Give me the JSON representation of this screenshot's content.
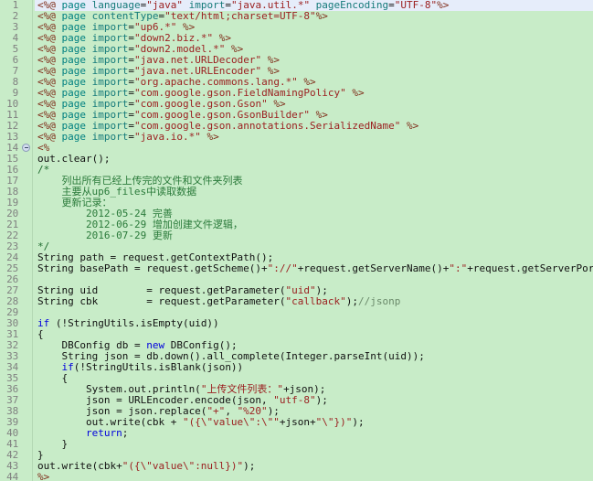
{
  "editor": {
    "name": "jsp-code-editor",
    "background": "#c8ecc8",
    "selection_color": "#e6edfa",
    "gutter_color": "#808080",
    "total_lines": 44,
    "fold_marker_line": 14
  },
  "lines": [
    {
      "n": "1",
      "selected": true,
      "fold": false,
      "tokens": [
        {
          "c": "t-dir",
          "t": "<%@"
        },
        {
          "c": "t-tag",
          "t": " page "
        },
        {
          "c": "t-attr",
          "t": "language"
        },
        {
          "c": "t-plain",
          "t": "="
        },
        {
          "c": "t-str",
          "t": "\"java\""
        },
        {
          "c": "t-attr",
          "t": " import"
        },
        {
          "c": "t-plain",
          "t": "="
        },
        {
          "c": "t-str",
          "t": "\"java.util.*\""
        },
        {
          "c": "t-attr",
          "t": " pageEncoding"
        },
        {
          "c": "t-plain",
          "t": "="
        },
        {
          "c": "t-str",
          "t": "\"UTF-8\""
        },
        {
          "c": "t-dir",
          "t": "%>"
        }
      ]
    },
    {
      "n": "2",
      "selected": false,
      "fold": false,
      "tokens": [
        {
          "c": "t-dir",
          "t": "<%@"
        },
        {
          "c": "t-tag",
          "t": " page "
        },
        {
          "c": "t-attr",
          "t": "contentType"
        },
        {
          "c": "t-plain",
          "t": "="
        },
        {
          "c": "t-str",
          "t": "\"text/html;charset=UTF-8\""
        },
        {
          "c": "t-dir",
          "t": "%>"
        }
      ]
    },
    {
      "n": "3",
      "selected": false,
      "fold": false,
      "tokens": [
        {
          "c": "t-dir",
          "t": "<%@"
        },
        {
          "c": "t-tag",
          "t": " page "
        },
        {
          "c": "t-attr",
          "t": "import"
        },
        {
          "c": "t-plain",
          "t": "="
        },
        {
          "c": "t-str",
          "t": "\"up6.*\""
        },
        {
          "c": "t-dir",
          "t": " %>"
        }
      ]
    },
    {
      "n": "4",
      "selected": false,
      "fold": false,
      "tokens": [
        {
          "c": "t-dir",
          "t": "<%@"
        },
        {
          "c": "t-tag",
          "t": " page "
        },
        {
          "c": "t-attr",
          "t": "import"
        },
        {
          "c": "t-plain",
          "t": "="
        },
        {
          "c": "t-str",
          "t": "\"down2.biz.*\""
        },
        {
          "c": "t-dir",
          "t": " %>"
        }
      ]
    },
    {
      "n": "5",
      "selected": false,
      "fold": false,
      "tokens": [
        {
          "c": "t-dir",
          "t": "<%@"
        },
        {
          "c": "t-tag",
          "t": " page "
        },
        {
          "c": "t-attr",
          "t": "import"
        },
        {
          "c": "t-plain",
          "t": "="
        },
        {
          "c": "t-str",
          "t": "\"down2.model.*\""
        },
        {
          "c": "t-dir",
          "t": " %>"
        }
      ]
    },
    {
      "n": "6",
      "selected": false,
      "fold": false,
      "tokens": [
        {
          "c": "t-dir",
          "t": "<%@"
        },
        {
          "c": "t-tag",
          "t": " page "
        },
        {
          "c": "t-attr",
          "t": "import"
        },
        {
          "c": "t-plain",
          "t": "="
        },
        {
          "c": "t-str",
          "t": "\"java.net.URLDecoder\""
        },
        {
          "c": "t-dir",
          "t": " %>"
        }
      ]
    },
    {
      "n": "7",
      "selected": false,
      "fold": false,
      "tokens": [
        {
          "c": "t-dir",
          "t": "<%@"
        },
        {
          "c": "t-tag",
          "t": " page "
        },
        {
          "c": "t-attr",
          "t": "import"
        },
        {
          "c": "t-plain",
          "t": "="
        },
        {
          "c": "t-str",
          "t": "\"java.net.URLEncoder\""
        },
        {
          "c": "t-dir",
          "t": " %>"
        }
      ]
    },
    {
      "n": "8",
      "selected": false,
      "fold": false,
      "tokens": [
        {
          "c": "t-dir",
          "t": "<%@"
        },
        {
          "c": "t-tag",
          "t": " page "
        },
        {
          "c": "t-attr",
          "t": "import"
        },
        {
          "c": "t-plain",
          "t": "="
        },
        {
          "c": "t-str",
          "t": "\"org.apache.commons.lang.*\""
        },
        {
          "c": "t-dir",
          "t": " %>"
        }
      ]
    },
    {
      "n": "9",
      "selected": false,
      "fold": false,
      "tokens": [
        {
          "c": "t-dir",
          "t": "<%@"
        },
        {
          "c": "t-tag",
          "t": " page "
        },
        {
          "c": "t-attr",
          "t": "import"
        },
        {
          "c": "t-plain",
          "t": "="
        },
        {
          "c": "t-str",
          "t": "\"com.google.gson.FieldNamingPolicy\""
        },
        {
          "c": "t-dir",
          "t": " %>"
        }
      ]
    },
    {
      "n": "10",
      "selected": false,
      "fold": false,
      "tokens": [
        {
          "c": "t-dir",
          "t": "<%@"
        },
        {
          "c": "t-tag",
          "t": " page "
        },
        {
          "c": "t-attr",
          "t": "import"
        },
        {
          "c": "t-plain",
          "t": "="
        },
        {
          "c": "t-str",
          "t": "\"com.google.gson.Gson\""
        },
        {
          "c": "t-dir",
          "t": " %>"
        }
      ]
    },
    {
      "n": "11",
      "selected": false,
      "fold": false,
      "tokens": [
        {
          "c": "t-dir",
          "t": "<%@"
        },
        {
          "c": "t-tag",
          "t": " page "
        },
        {
          "c": "t-attr",
          "t": "import"
        },
        {
          "c": "t-plain",
          "t": "="
        },
        {
          "c": "t-str",
          "t": "\"com.google.gson.GsonBuilder\""
        },
        {
          "c": "t-dir",
          "t": " %>"
        }
      ]
    },
    {
      "n": "12",
      "selected": false,
      "fold": false,
      "tokens": [
        {
          "c": "t-dir",
          "t": "<%@"
        },
        {
          "c": "t-tag",
          "t": " page "
        },
        {
          "c": "t-attr",
          "t": "import"
        },
        {
          "c": "t-plain",
          "t": "="
        },
        {
          "c": "t-str",
          "t": "\"com.google.gson.annotations.SerializedName\""
        },
        {
          "c": "t-dir",
          "t": " %>"
        }
      ]
    },
    {
      "n": "13",
      "selected": false,
      "fold": false,
      "tokens": [
        {
          "c": "t-dir",
          "t": "<%@"
        },
        {
          "c": "t-tag",
          "t": " page "
        },
        {
          "c": "t-attr",
          "t": "import"
        },
        {
          "c": "t-plain",
          "t": "="
        },
        {
          "c": "t-str",
          "t": "\"java.io.*\""
        },
        {
          "c": "t-dir",
          "t": " %>"
        }
      ]
    },
    {
      "n": "14",
      "selected": false,
      "fold": true,
      "tokens": [
        {
          "c": "t-dir",
          "t": "<%"
        }
      ]
    },
    {
      "n": "15",
      "selected": false,
      "fold": false,
      "tokens": [
        {
          "c": "t-plain",
          "t": "out.clear();"
        }
      ]
    },
    {
      "n": "16",
      "selected": false,
      "fold": false,
      "tokens": [
        {
          "c": "t-cmt",
          "t": "/*"
        }
      ]
    },
    {
      "n": "17",
      "selected": false,
      "fold": false,
      "tokens": [
        {
          "c": "t-cmtcn",
          "t": "    列出所有已经上传完的文件和文件夹列表"
        }
      ]
    },
    {
      "n": "18",
      "selected": false,
      "fold": false,
      "tokens": [
        {
          "c": "t-cmtcn",
          "t": "    主要从up6_files中读取数据"
        }
      ]
    },
    {
      "n": "19",
      "selected": false,
      "fold": false,
      "tokens": [
        {
          "c": "t-cmtcn",
          "t": "    更新记录："
        }
      ]
    },
    {
      "n": "20",
      "selected": false,
      "fold": false,
      "tokens": [
        {
          "c": "t-cmtcn",
          "t": "        2012-05-24 完善"
        }
      ]
    },
    {
      "n": "21",
      "selected": false,
      "fold": false,
      "tokens": [
        {
          "c": "t-cmtcn",
          "t": "        2012-06-29 增加创建文件逻辑，"
        }
      ]
    },
    {
      "n": "22",
      "selected": false,
      "fold": false,
      "tokens": [
        {
          "c": "t-cmtcn",
          "t": "        2016-07-29 更新"
        }
      ]
    },
    {
      "n": "23",
      "selected": false,
      "fold": false,
      "tokens": [
        {
          "c": "t-cmt",
          "t": "*/"
        }
      ]
    },
    {
      "n": "24",
      "selected": false,
      "fold": false,
      "tokens": [
        {
          "c": "t-plain",
          "t": "String path = request.getContextPath();"
        }
      ]
    },
    {
      "n": "25",
      "selected": false,
      "fold": false,
      "tokens": [
        {
          "c": "t-plain",
          "t": "String basePath = request.getScheme()+"
        },
        {
          "c": "t-str",
          "t": "\"://\""
        },
        {
          "c": "t-plain",
          "t": "+request.getServerName()+"
        },
        {
          "c": "t-str",
          "t": "\":\""
        },
        {
          "c": "t-plain",
          "t": "+request.getServerPort()+path+"
        },
        {
          "c": "t-str",
          "t": "\"/\""
        },
        {
          "c": "t-plain",
          "t": ";"
        }
      ]
    },
    {
      "n": "26",
      "selected": false,
      "fold": false,
      "tokens": []
    },
    {
      "n": "27",
      "selected": false,
      "fold": false,
      "tokens": [
        {
          "c": "t-plain",
          "t": "String uid        = request.getParameter("
        },
        {
          "c": "t-str",
          "t": "\"uid\""
        },
        {
          "c": "t-plain",
          "t": ");"
        }
      ]
    },
    {
      "n": "28",
      "selected": false,
      "fold": false,
      "tokens": [
        {
          "c": "t-plain",
          "t": "String cbk        = request.getParameter("
        },
        {
          "c": "t-str",
          "t": "\"callback\""
        },
        {
          "c": "t-plain",
          "t": ");"
        },
        {
          "c": "t-linecmt",
          "t": "//jsonp"
        }
      ]
    },
    {
      "n": "29",
      "selected": false,
      "fold": false,
      "tokens": []
    },
    {
      "n": "30",
      "selected": false,
      "fold": false,
      "tokens": [
        {
          "c": "t-kw",
          "t": "if"
        },
        {
          "c": "t-plain",
          "t": " (!StringUtils.isEmpty(uid))"
        }
      ]
    },
    {
      "n": "31",
      "selected": false,
      "fold": false,
      "tokens": [
        {
          "c": "t-plain",
          "t": "{"
        }
      ]
    },
    {
      "n": "32",
      "selected": false,
      "fold": false,
      "tokens": [
        {
          "c": "t-plain",
          "t": "    DBConfig db = "
        },
        {
          "c": "t-kw",
          "t": "new"
        },
        {
          "c": "t-plain",
          "t": " DBConfig();"
        }
      ]
    },
    {
      "n": "33",
      "selected": false,
      "fold": false,
      "tokens": [
        {
          "c": "t-plain",
          "t": "    String json = db.down().all_complete(Integer.parseInt(uid));"
        }
      ]
    },
    {
      "n": "34",
      "selected": false,
      "fold": false,
      "tokens": [
        {
          "c": "t-plain",
          "t": "    "
        },
        {
          "c": "t-kw",
          "t": "if"
        },
        {
          "c": "t-plain",
          "t": "(!StringUtils.isBlank(json))"
        }
      ]
    },
    {
      "n": "35",
      "selected": false,
      "fold": false,
      "tokens": [
        {
          "c": "t-plain",
          "t": "    {"
        }
      ]
    },
    {
      "n": "36",
      "selected": false,
      "fold": false,
      "tokens": [
        {
          "c": "t-plain",
          "t": "        System.out.println("
        },
        {
          "c": "t-str",
          "t": "\"上传文件列表：\""
        },
        {
          "c": "t-plain",
          "t": "+json);"
        }
      ]
    },
    {
      "n": "37",
      "selected": false,
      "fold": false,
      "tokens": [
        {
          "c": "t-plain",
          "t": "        json = URLEncoder.encode(json, "
        },
        {
          "c": "t-str",
          "t": "\"utf-8\""
        },
        {
          "c": "t-plain",
          "t": ");"
        }
      ]
    },
    {
      "n": "38",
      "selected": false,
      "fold": false,
      "tokens": [
        {
          "c": "t-plain",
          "t": "        json = json.replace("
        },
        {
          "c": "t-str",
          "t": "\"+\""
        },
        {
          "c": "t-plain",
          "t": ", "
        },
        {
          "c": "t-str",
          "t": "\"%20\""
        },
        {
          "c": "t-plain",
          "t": ");"
        }
      ]
    },
    {
      "n": "39",
      "selected": false,
      "fold": false,
      "tokens": [
        {
          "c": "t-plain",
          "t": "        out.write(cbk + "
        },
        {
          "c": "t-str",
          "t": "\"({\\\"value\\\":\\\"\""
        },
        {
          "c": "t-plain",
          "t": "+json+"
        },
        {
          "c": "t-str",
          "t": "\"\\\"})\""
        },
        {
          "c": "t-plain",
          "t": ");"
        }
      ]
    },
    {
      "n": "40",
      "selected": false,
      "fold": false,
      "tokens": [
        {
          "c": "t-plain",
          "t": "        "
        },
        {
          "c": "t-kw",
          "t": "return"
        },
        {
          "c": "t-plain",
          "t": ";"
        }
      ]
    },
    {
      "n": "41",
      "selected": false,
      "fold": false,
      "tokens": [
        {
          "c": "t-plain",
          "t": "    }"
        }
      ]
    },
    {
      "n": "42",
      "selected": false,
      "fold": false,
      "tokens": [
        {
          "c": "t-plain",
          "t": "}"
        }
      ]
    },
    {
      "n": "43",
      "selected": false,
      "fold": false,
      "tokens": [
        {
          "c": "t-plain",
          "t": "out.write(cbk+"
        },
        {
          "c": "t-str",
          "t": "\"({\\\"value\\\":null})\""
        },
        {
          "c": "t-plain",
          "t": ");"
        }
      ]
    },
    {
      "n": "44",
      "selected": false,
      "fold": false,
      "tokens": [
        {
          "c": "t-dir",
          "t": "%>"
        }
      ]
    }
  ]
}
